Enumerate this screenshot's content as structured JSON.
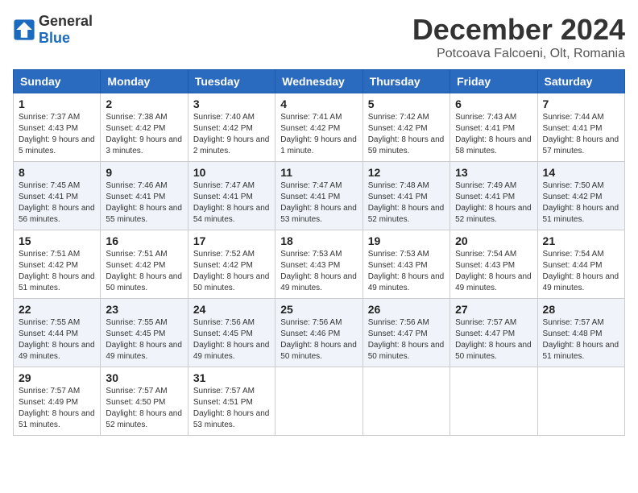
{
  "logo": {
    "general": "General",
    "blue": "Blue"
  },
  "title": "December 2024",
  "location": "Potcoava Falcoeni, Olt, Romania",
  "weekdays": [
    "Sunday",
    "Monday",
    "Tuesday",
    "Wednesday",
    "Thursday",
    "Friday",
    "Saturday"
  ],
  "weeks": [
    [
      {
        "day": "1",
        "sunrise": "7:37 AM",
        "sunset": "4:43 PM",
        "daylight": "9 hours and 5 minutes."
      },
      {
        "day": "2",
        "sunrise": "7:38 AM",
        "sunset": "4:42 PM",
        "daylight": "9 hours and 3 minutes."
      },
      {
        "day": "3",
        "sunrise": "7:40 AM",
        "sunset": "4:42 PM",
        "daylight": "9 hours and 2 minutes."
      },
      {
        "day": "4",
        "sunrise": "7:41 AM",
        "sunset": "4:42 PM",
        "daylight": "9 hours and 1 minute."
      },
      {
        "day": "5",
        "sunrise": "7:42 AM",
        "sunset": "4:42 PM",
        "daylight": "8 hours and 59 minutes."
      },
      {
        "day": "6",
        "sunrise": "7:43 AM",
        "sunset": "4:41 PM",
        "daylight": "8 hours and 58 minutes."
      },
      {
        "day": "7",
        "sunrise": "7:44 AM",
        "sunset": "4:41 PM",
        "daylight": "8 hours and 57 minutes."
      }
    ],
    [
      {
        "day": "8",
        "sunrise": "7:45 AM",
        "sunset": "4:41 PM",
        "daylight": "8 hours and 56 minutes."
      },
      {
        "day": "9",
        "sunrise": "7:46 AM",
        "sunset": "4:41 PM",
        "daylight": "8 hours and 55 minutes."
      },
      {
        "day": "10",
        "sunrise": "7:47 AM",
        "sunset": "4:41 PM",
        "daylight": "8 hours and 54 minutes."
      },
      {
        "day": "11",
        "sunrise": "7:47 AM",
        "sunset": "4:41 PM",
        "daylight": "8 hours and 53 minutes."
      },
      {
        "day": "12",
        "sunrise": "7:48 AM",
        "sunset": "4:41 PM",
        "daylight": "8 hours and 52 minutes."
      },
      {
        "day": "13",
        "sunrise": "7:49 AM",
        "sunset": "4:41 PM",
        "daylight": "8 hours and 52 minutes."
      },
      {
        "day": "14",
        "sunrise": "7:50 AM",
        "sunset": "4:42 PM",
        "daylight": "8 hours and 51 minutes."
      }
    ],
    [
      {
        "day": "15",
        "sunrise": "7:51 AM",
        "sunset": "4:42 PM",
        "daylight": "8 hours and 51 minutes."
      },
      {
        "day": "16",
        "sunrise": "7:51 AM",
        "sunset": "4:42 PM",
        "daylight": "8 hours and 50 minutes."
      },
      {
        "day": "17",
        "sunrise": "7:52 AM",
        "sunset": "4:42 PM",
        "daylight": "8 hours and 50 minutes."
      },
      {
        "day": "18",
        "sunrise": "7:53 AM",
        "sunset": "4:43 PM",
        "daylight": "8 hours and 49 minutes."
      },
      {
        "day": "19",
        "sunrise": "7:53 AM",
        "sunset": "4:43 PM",
        "daylight": "8 hours and 49 minutes."
      },
      {
        "day": "20",
        "sunrise": "7:54 AM",
        "sunset": "4:43 PM",
        "daylight": "8 hours and 49 minutes."
      },
      {
        "day": "21",
        "sunrise": "7:54 AM",
        "sunset": "4:44 PM",
        "daylight": "8 hours and 49 minutes."
      }
    ],
    [
      {
        "day": "22",
        "sunrise": "7:55 AM",
        "sunset": "4:44 PM",
        "daylight": "8 hours and 49 minutes."
      },
      {
        "day": "23",
        "sunrise": "7:55 AM",
        "sunset": "4:45 PM",
        "daylight": "8 hours and 49 minutes."
      },
      {
        "day": "24",
        "sunrise": "7:56 AM",
        "sunset": "4:45 PM",
        "daylight": "8 hours and 49 minutes."
      },
      {
        "day": "25",
        "sunrise": "7:56 AM",
        "sunset": "4:46 PM",
        "daylight": "8 hours and 50 minutes."
      },
      {
        "day": "26",
        "sunrise": "7:56 AM",
        "sunset": "4:47 PM",
        "daylight": "8 hours and 50 minutes."
      },
      {
        "day": "27",
        "sunrise": "7:57 AM",
        "sunset": "4:47 PM",
        "daylight": "8 hours and 50 minutes."
      },
      {
        "day": "28",
        "sunrise": "7:57 AM",
        "sunset": "4:48 PM",
        "daylight": "8 hours and 51 minutes."
      }
    ],
    [
      {
        "day": "29",
        "sunrise": "7:57 AM",
        "sunset": "4:49 PM",
        "daylight": "8 hours and 51 minutes."
      },
      {
        "day": "30",
        "sunrise": "7:57 AM",
        "sunset": "4:50 PM",
        "daylight": "8 hours and 52 minutes."
      },
      {
        "day": "31",
        "sunrise": "7:57 AM",
        "sunset": "4:51 PM",
        "daylight": "8 hours and 53 minutes."
      },
      null,
      null,
      null,
      null
    ]
  ]
}
